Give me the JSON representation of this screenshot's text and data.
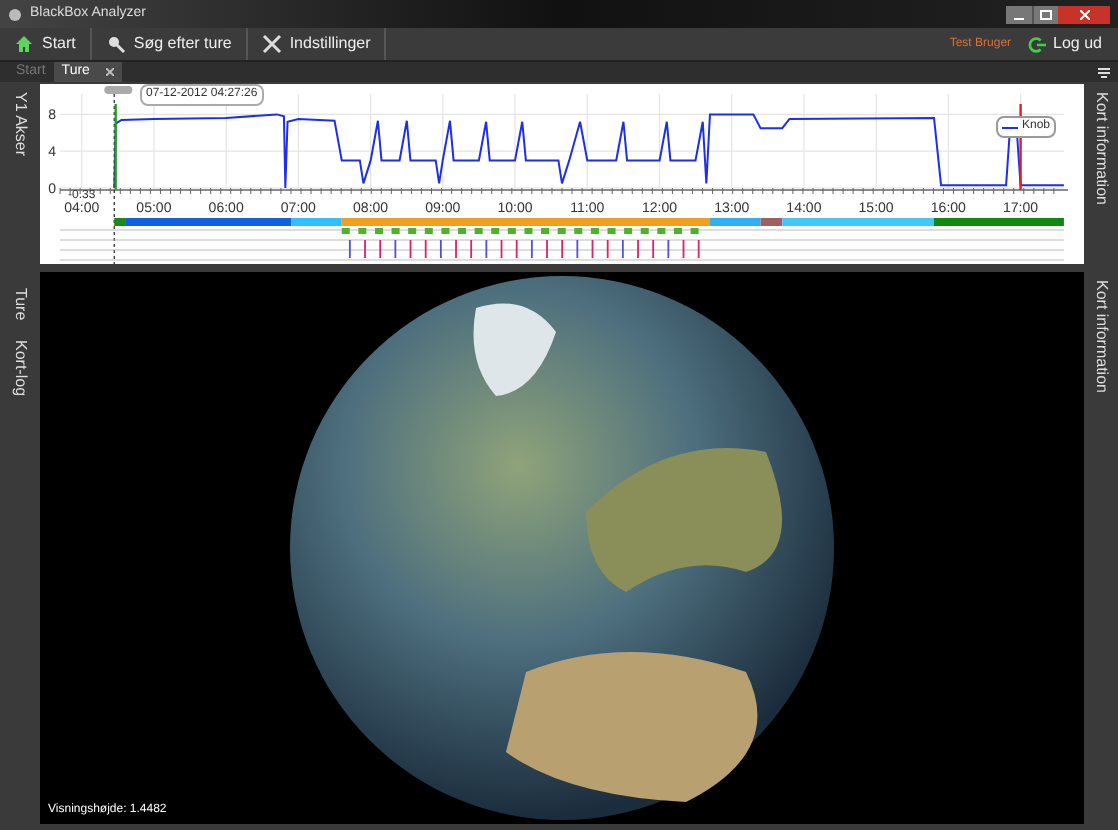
{
  "window": {
    "title": "BlackBox Analyzer"
  },
  "toolbar": {
    "buttons": [
      {
        "kind": "home",
        "label": "Start"
      },
      {
        "kind": "search",
        "label": "Søg efter ture"
      },
      {
        "kind": "settings",
        "label": "Indstillinger"
      }
    ],
    "user": "Test Bruger",
    "logout": "Log ud"
  },
  "tabs": [
    {
      "label": "Start",
      "selected": false,
      "closable": false
    },
    {
      "label": "Ture",
      "selected": true,
      "closable": true
    }
  ],
  "left_panel_tabs": [
    "Y1 Akser"
  ],
  "right_panel_tabs": [
    "Kort information"
  ],
  "chart": {
    "cursor_label": "07-12-2012 04:27:26",
    "cursor_value": "-0.33",
    "chart_data": {
      "type": "line",
      "x": [
        4.45,
        4.47,
        4.55,
        5,
        6,
        6.7,
        6.8,
        6.82,
        6.85,
        7.0,
        7.5,
        7.6,
        7.85,
        7.9,
        8.0,
        8.1,
        8.15,
        8.4,
        8.5,
        8.55,
        8.9,
        8.95,
        9.0,
        9.1,
        9.15,
        9.5,
        9.6,
        9.65,
        10.0,
        10.1,
        10.15,
        10.6,
        10.65,
        10.75,
        10.9,
        11.0,
        11.4,
        11.5,
        11.55,
        12.0,
        12.1,
        12.15,
        12.5,
        12.6,
        12.65,
        12.7,
        13.3,
        13.4,
        13.7,
        13.8,
        15.8,
        15.9,
        16.8,
        16.85,
        16.95,
        17.0,
        17.6
      ],
      "series": [
        {
          "name": "Knob",
          "color": "#1f2fe8",
          "values": [
            0,
            7,
            7.4,
            7.5,
            7.6,
            8,
            7.8,
            0,
            7.2,
            7.5,
            7.3,
            3,
            3,
            0.5,
            3,
            7.3,
            3,
            3,
            7.3,
            3,
            3,
            0.5,
            3,
            7.3,
            3,
            3,
            7.2,
            3,
            3,
            7.2,
            3,
            3,
            0.5,
            3,
            7.2,
            3,
            3,
            7.2,
            3,
            3,
            7.2,
            3,
            3,
            7.2,
            0.5,
            8,
            8,
            6.5,
            6.5,
            7.5,
            7.6,
            0.3,
            0.3,
            6,
            6,
            0.3,
            0.3
          ]
        }
      ],
      "grid": true,
      "ref_lines": [
        {
          "axis": "x",
          "value": 4.45,
          "color": "#222222"
        },
        {
          "axis": "x",
          "value": 4.47,
          "color": "#2a9a2a"
        },
        {
          "axis": "x",
          "value": 17.0,
          "color": "#e02020"
        }
      ],
      "xlim": [
        3.7,
        17.6
      ],
      "ylim": [
        0,
        9
      ],
      "yticks": [
        0,
        4,
        8
      ],
      "xticks": [
        {
          "value": 4,
          "label": "04:00"
        },
        {
          "value": 5,
          "label": "05:00"
        },
        {
          "value": 6,
          "label": "06:00"
        },
        {
          "value": 7,
          "label": "07:00"
        },
        {
          "value": 8,
          "label": "08:00"
        },
        {
          "value": 9,
          "label": "09:00"
        },
        {
          "value": 10,
          "label": "10:00"
        },
        {
          "value": 11,
          "label": "11:00"
        },
        {
          "value": 12,
          "label": "12:00"
        },
        {
          "value": 13,
          "label": "13:00"
        },
        {
          "value": 14,
          "label": "14:00"
        },
        {
          "value": 15,
          "label": "15:00"
        },
        {
          "value": 16,
          "label": "16:00"
        },
        {
          "value": 17,
          "label": "17:00"
        }
      ]
    }
  },
  "map_left_tabs": [
    "Ture",
    "Kort-log"
  ],
  "map_right_tabs": [
    "Kort information"
  ],
  "status": "Visningshøjde: 1.4482"
}
